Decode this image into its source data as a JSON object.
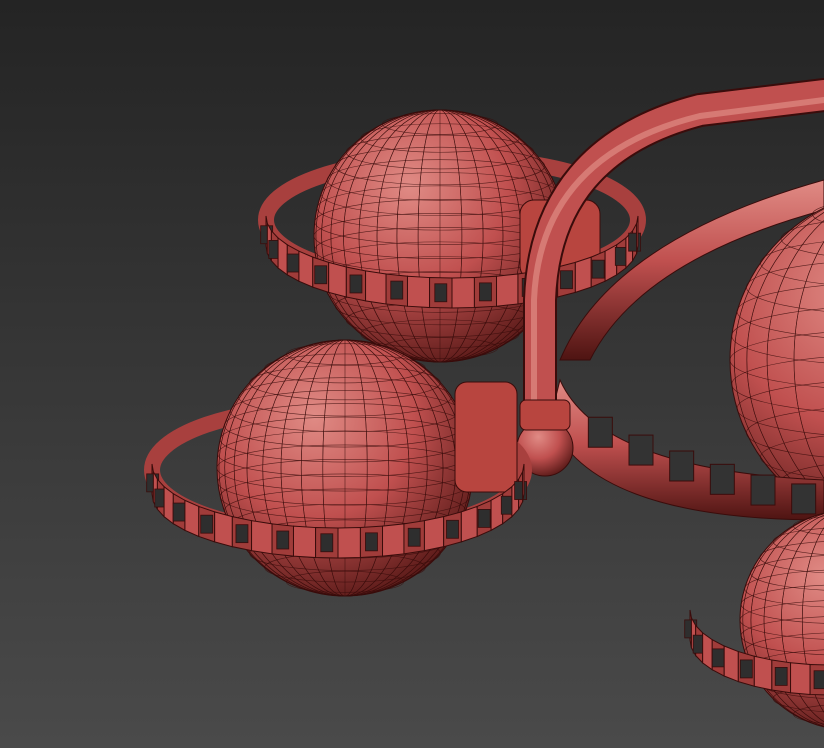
{
  "viewport": {
    "background_top": "#242424",
    "background_bottom": "#4a4a4a"
  },
  "model": {
    "base_color": "#c0504f",
    "light_color": "#e08b85",
    "dark_color": "#4e1412",
    "wire_color": "#3a0c0b",
    "parts": [
      "sphere",
      "ring-band",
      "joint-cap",
      "arm-tube",
      "hub-ball"
    ]
  }
}
